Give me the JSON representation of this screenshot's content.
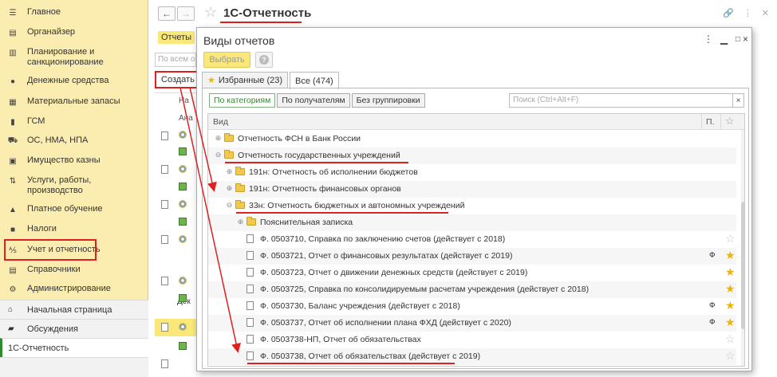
{
  "sidebar": {
    "items": [
      {
        "label": "Главное",
        "icon": "menu-icon"
      },
      {
        "label": "Органайзер",
        "icon": "organizer-icon"
      },
      {
        "label": "Планирование и санкционирование",
        "icon": "planning-icon"
      },
      {
        "label": "Денежные средства",
        "icon": "money-icon"
      },
      {
        "label": "Материальные запасы",
        "icon": "inventory-icon"
      },
      {
        "label": "ГСМ",
        "icon": "fuel-icon"
      },
      {
        "label": "ОС, НМА, НПА",
        "icon": "assets-icon"
      },
      {
        "label": "Имущество казны",
        "icon": "treasury-icon"
      },
      {
        "label": "Услуги, работы, производство",
        "icon": "services-icon"
      },
      {
        "label": "Платное обучение",
        "icon": "education-icon"
      },
      {
        "label": "Налоги",
        "icon": "taxes-icon"
      },
      {
        "label": "Учет и отчетность",
        "icon": "accounting-icon"
      },
      {
        "label": "Справочники",
        "icon": "catalogs-icon"
      },
      {
        "label": "Администрирование",
        "icon": "admin-icon"
      }
    ],
    "bottom": [
      {
        "label": "Начальная страница",
        "icon": "home-icon"
      },
      {
        "label": "Обсуждения",
        "icon": "chat-icon"
      },
      {
        "label": "1С-Отчетность",
        "icon": ""
      }
    ]
  },
  "header": {
    "back": "←",
    "forward": "→",
    "title": "1С-Отчетность"
  },
  "background_form": {
    "tab": "Отчеты",
    "search_placeholder": "По всем о",
    "create_label": "Создать",
    "col_header_1": "На",
    "col_header_2": "Ана",
    "row_text": "Дек"
  },
  "modal": {
    "title": "Виды отчетов",
    "choose_label": "Выбрать",
    "help_label": "?",
    "tabs": [
      {
        "label": "Избранные (23)"
      },
      {
        "label": "Все (474)"
      }
    ],
    "grouping": [
      "По категориям",
      "По получателям",
      "Без группировки"
    ],
    "search_placeholder": "Поиск (Ctrl+Alt+F)",
    "search_clear": "×",
    "columns": {
      "vid": "Вид",
      "p": "П."
    },
    "rows": [
      {
        "text": "Отчетность ФСН в Банк России",
        "type": "folder",
        "level": 0,
        "exp": "+",
        "flag": "",
        "fav": null
      },
      {
        "text": "Отчетность государственных учреждений",
        "type": "folder",
        "level": 0,
        "exp": "−",
        "flag": "",
        "fav": null
      },
      {
        "text": "191н: Отчетность об исполнении бюджетов",
        "type": "folder",
        "level": 1,
        "exp": "+",
        "flag": "",
        "fav": null
      },
      {
        "text": "191н: Отчетность финансовых органов",
        "type": "folder",
        "level": 1,
        "exp": "+",
        "flag": "",
        "fav": null
      },
      {
        "text": "33н: Отчетность бюджетных и автономных учреждений",
        "type": "folder",
        "level": 1,
        "exp": "−",
        "flag": "",
        "fav": null
      },
      {
        "text": "Пояснительная записка",
        "type": "folder",
        "level": 2,
        "exp": "+",
        "flag": "",
        "fav": null
      },
      {
        "text": "Ф. 0503710, Справка по заключению счетов (действует с 2018)",
        "type": "file",
        "level": 2,
        "exp": "",
        "flag": "",
        "fav": false
      },
      {
        "text": "Ф. 0503721, Отчет о финансовых результатах (действует с 2019)",
        "type": "file",
        "level": 2,
        "exp": "",
        "flag": "Ф",
        "fav": true
      },
      {
        "text": "Ф. 0503723, Отчет о движении денежных средств (действует с 2019)",
        "type": "file",
        "level": 2,
        "exp": "",
        "flag": "",
        "fav": true
      },
      {
        "text": "Ф. 0503725, Справка по консолидируемым расчетам учреждения (действует с 2018)",
        "type": "file",
        "level": 2,
        "exp": "",
        "flag": "",
        "fav": true
      },
      {
        "text": "Ф. 0503730, Баланс учреждения (действует с 2018)",
        "type": "file",
        "level": 2,
        "exp": "",
        "flag": "Ф",
        "fav": true
      },
      {
        "text": "Ф. 0503737, Отчет об исполнении плана ФХД (действует с 2020)",
        "type": "file",
        "level": 2,
        "exp": "",
        "flag": "Ф",
        "fav": true
      },
      {
        "text": "Ф. 0503738-НП, Отчет об обязательствах",
        "type": "file",
        "level": 2,
        "exp": "",
        "flag": "",
        "fav": false
      },
      {
        "text": "Ф. 0503738, Отчет об обязательствах (действует с 2019)",
        "type": "file",
        "level": 2,
        "exp": "",
        "flag": "",
        "fav": false
      }
    ]
  },
  "colors": {
    "accent": "#fbe87a",
    "sidebar": "#fbedb0",
    "highlight": "#e02020",
    "star": "#f0b400"
  }
}
